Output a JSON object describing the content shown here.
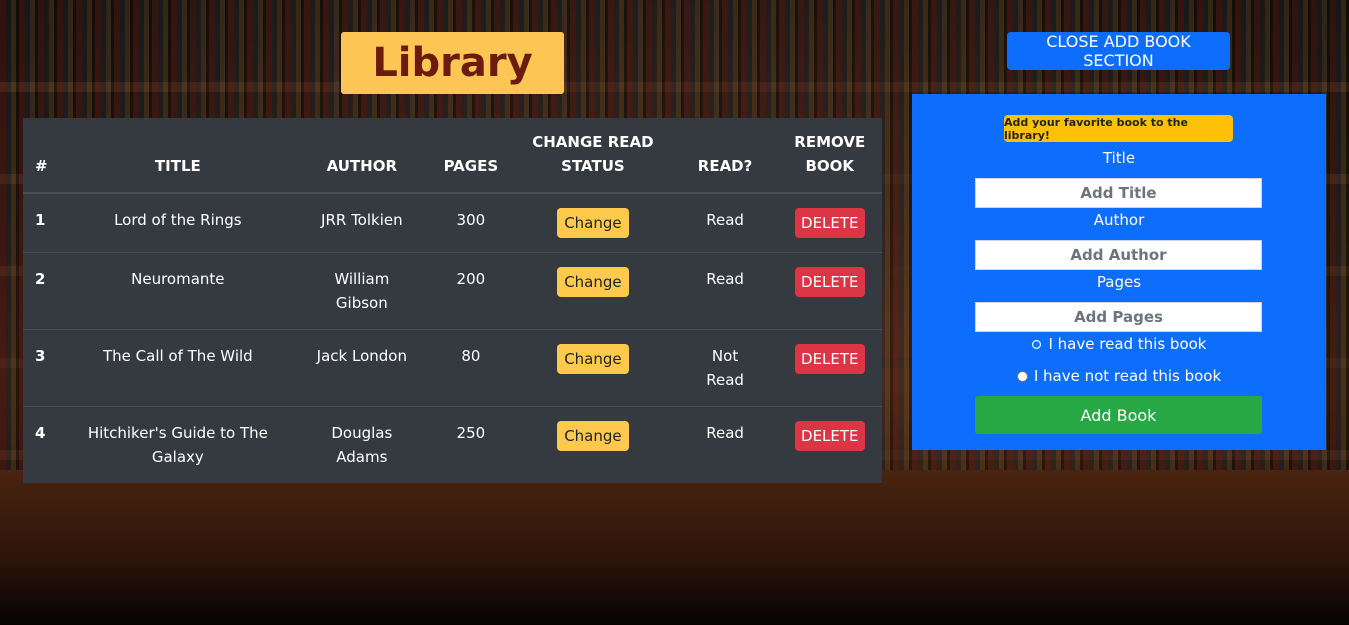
{
  "header": {
    "title": "Library",
    "close_button_label": "CLOSE ADD BOOK SECTION"
  },
  "table": {
    "columns": [
      "#",
      "TITLE",
      "AUTHOR",
      "PAGES",
      "CHANGE READ STATUS",
      "READ?",
      "REMOVE BOOK"
    ],
    "change_label": "Change",
    "delete_label": "DELETE",
    "rows": [
      {
        "num": "1",
        "title": "Lord of the Rings",
        "author": "JRR Tolkien",
        "pages": "300",
        "read": "Read"
      },
      {
        "num": "2",
        "title": "Neuromante",
        "author": "William Gibson",
        "pages": "200",
        "read": "Read"
      },
      {
        "num": "3",
        "title": "The Call of The Wild",
        "author": "Jack London",
        "pages": "80",
        "read": "Not Read"
      },
      {
        "num": "4",
        "title": "Hitchiker's Guide to The Galaxy",
        "author": "Douglas Adams",
        "pages": "250",
        "read": "Read"
      }
    ]
  },
  "form": {
    "badge": "Add your favorite book to the library!",
    "title_label": "Title",
    "title_placeholder": "Add Title",
    "author_label": "Author",
    "author_placeholder": "Add Author",
    "pages_label": "Pages",
    "pages_placeholder": "Add Pages",
    "radio_read_label": "I have read this book",
    "radio_read_checked": true,
    "radio_not_read_label": "I have not read this book",
    "submit_label": "Add Book"
  },
  "colors": {
    "title_bg": "#fdc654",
    "title_text": "#6b1c0e",
    "primary": "#0d6efd",
    "table_bg": "#343a40",
    "change_btn": "#ffc94d",
    "delete_btn": "#dc3545",
    "badge": "#ffc107",
    "add_btn": "#28a745"
  }
}
